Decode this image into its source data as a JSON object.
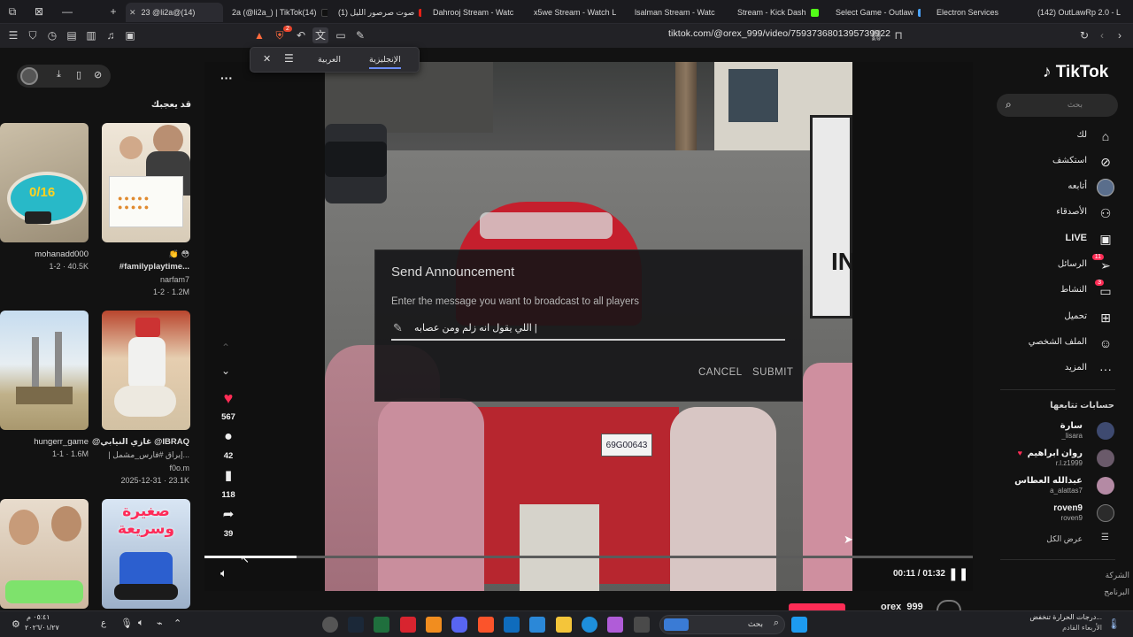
{
  "browser": {
    "tabs": [
      {
        "title": "23 @li2a@(14)",
        "active": true
      },
      {
        "title": "2a (@li2a_) | TikTok(14)"
      },
      {
        "title": "(1) صوت صرصور الليل"
      },
      {
        "title": "Dahrooj Stream - Watc"
      },
      {
        "title": "x5we Stream - Watch L"
      },
      {
        "title": "lsalman Stream - Watc"
      },
      {
        "title": "Stream - Kick Dash"
      },
      {
        "title": "Select Game - Outlaw"
      },
      {
        "title": "Electron Services"
      },
      {
        "title": "(142) OutLawRp 2.0 - L"
      }
    ],
    "url": "tiktok.com/@orex_999/video/7593736801395739922",
    "shield_badge": "2"
  },
  "translate_popup": {
    "lang1": "العربية",
    "lang2": "الإنجليزية"
  },
  "tiktok": {
    "logo": "TikTok",
    "search_placeholder": "بحث",
    "nav": [
      {
        "label": "لك",
        "icon": "home-icon"
      },
      {
        "label": "استكشف",
        "icon": "compass-icon"
      },
      {
        "label": "أتابعه",
        "icon": "avatar-icon"
      },
      {
        "label": "الأصدقاء",
        "icon": "friends-icon"
      },
      {
        "label": "LIVE",
        "icon": "live-icon"
      },
      {
        "label": "الرسائل",
        "icon": "messages-icon",
        "badge": "11"
      },
      {
        "label": "النشاط",
        "icon": "activity-icon",
        "badge": "3"
      },
      {
        "label": "تحميل",
        "icon": "upload-icon"
      },
      {
        "label": "الملف الشخصي",
        "icon": "profile-icon"
      },
      {
        "label": "المزيد",
        "icon": "more-icon"
      }
    ],
    "following_title": "حسابات تتابعها",
    "following": [
      {
        "name": "سارة",
        "handle": "_lisara"
      },
      {
        "name": "روان ابراهيم",
        "handle": "r.l.z1999"
      },
      {
        "name": "عبدالله العطاس",
        "handle": "a_alattas7"
      },
      {
        "name": "roven9",
        "handle": "roven9"
      }
    ],
    "see_all": "عرض الكل",
    "footer": [
      "الشركة",
      "البرنامج"
    ],
    "suggested_title": "قد يعجبك",
    "suggested": [
      {
        "name": "mohanadd000",
        "meta": "1-2 · 40.5K"
      },
      {
        "name": "#familyplaytime...",
        "sub": "narfam7",
        "meta": "1-2 · 1.2M",
        "emoji": "👏 😳"
      },
      {
        "name": "hungerr_game",
        "meta": "1-1 · 1.6M"
      },
      {
        "name": "@غازي النيابي @IBRAQ",
        "sub": "| إبراق #فارس_مشمل...",
        "sub2": "f0o.m",
        "meta": "2025-12-31 · 23.1K"
      },
      {
        "name": "",
        "meta": ""
      },
      {
        "name": "صغيرة وسريعة",
        "meta": ""
      }
    ],
    "actions": {
      "likes": "567",
      "comments": "42",
      "saves": "118",
      "shares": "39"
    },
    "player": {
      "time": "00:11 / 01:32",
      "progress": 0.12,
      "author": "orex_999"
    }
  },
  "game_dialog": {
    "title": "Send Announcement",
    "prompt": "Enter the message you want to broadcast to all players",
    "input": "اللي يقول انه زلم ومن عصابه |",
    "cancel": "CANCEL",
    "submit": "SUBMIT"
  },
  "game_scene": {
    "plate": "69G00643",
    "sign_text": "IN"
  },
  "taskbar": {
    "time": "٠٥:٤١ م",
    "date": "٢٠٢٦/٠١/٢٧",
    "search": "بحث",
    "weather": "درجات الحرارة تنخفض...",
    "weather_sub": "الأربعاء القادم",
    "lang": "ع"
  }
}
